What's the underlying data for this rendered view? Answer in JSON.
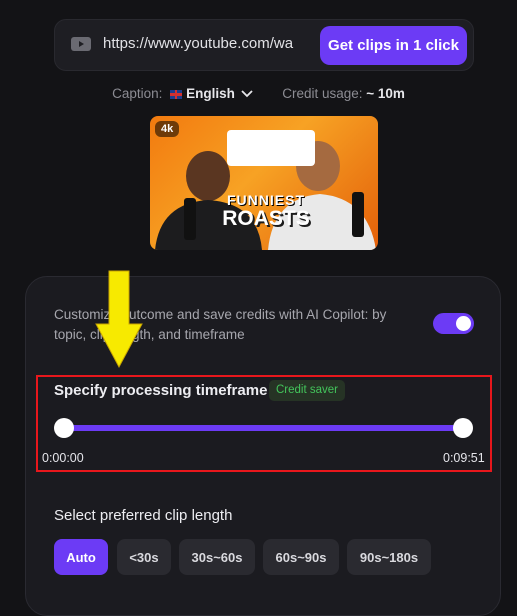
{
  "url_bar": {
    "value": "https://www.youtube.com/wa",
    "button_label": "Get clips in 1 click"
  },
  "caption_row": {
    "caption_label": "Caption:",
    "caption_value": "English",
    "credit_label": "Credit usage:",
    "credit_value": "~ 10m"
  },
  "thumbnail": {
    "resolution_badge": "4k",
    "title_line1": "FUNNIEST",
    "title_line2": "ROASTS"
  },
  "copilot": {
    "description": "Customize outcome and save credits with AI Copilot: by topic, clip length, and timeframe",
    "toggle_on": true
  },
  "timeframe": {
    "title": "Specify processing timeframe",
    "badge": "Credit saver",
    "start_time": "0:00:00",
    "end_time": "0:09:51"
  },
  "clip_length": {
    "title": "Select preferred clip length",
    "options": [
      "Auto",
      "<30s",
      "30s~60s",
      "60s~90s",
      "90s~180s"
    ],
    "selected": "Auto"
  },
  "colors": {
    "accent": "#6c3bf5",
    "highlight_box": "#e8171c",
    "arrow": "#f7ea00",
    "credit_badge_text": "#43c45b"
  }
}
